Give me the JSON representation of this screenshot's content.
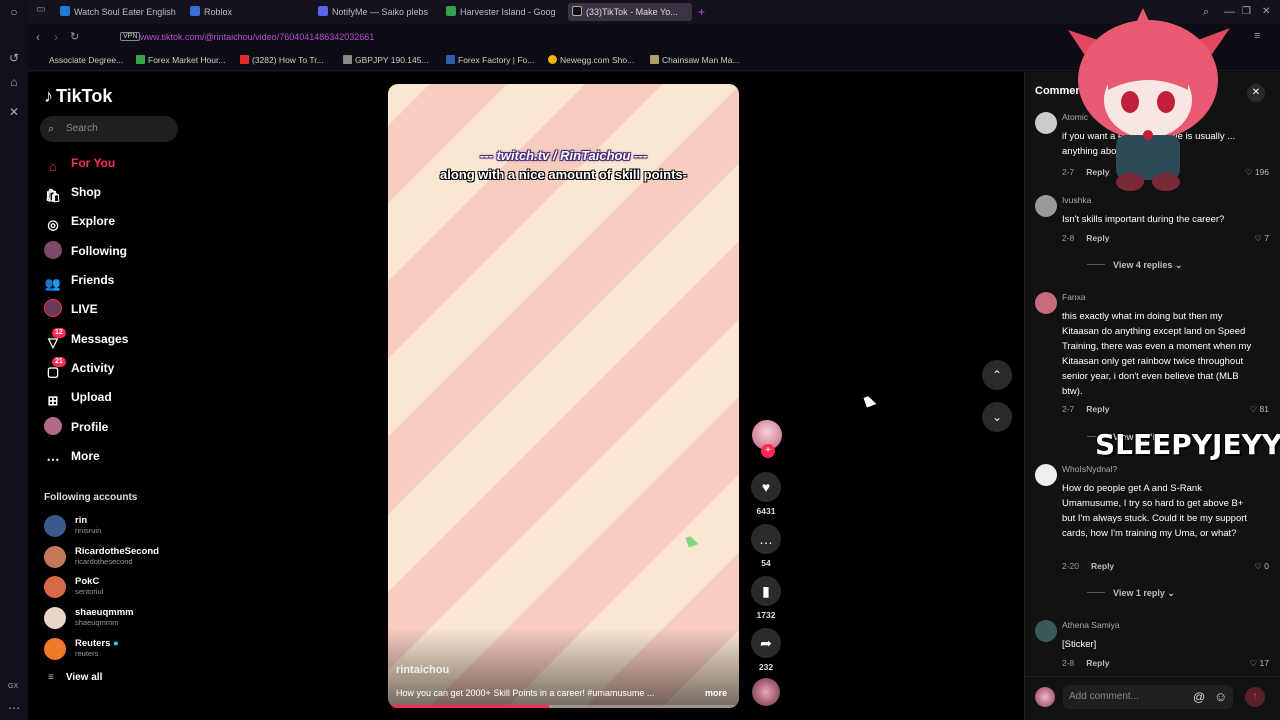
{
  "tabs": [
    {
      "label": "Watch Soul Eater English S",
      "color": "#1c7cd6"
    },
    {
      "label": "Roblox",
      "color": "#3b6fd8"
    },
    {
      "label": "NotifyMe — Saiko plebs",
      "color": "#5865f2"
    },
    {
      "label": "Harvester Island - Google",
      "color": "#2fa34f"
    },
    {
      "label": "(33)TikTok - Make Yo...",
      "color": "#111111"
    }
  ],
  "address": {
    "vpn": "VPN",
    "url": "www.tiktok.com/@rintaichou/video/7604041486342032661"
  },
  "bookmarks": [
    {
      "label": "Associate Degree...",
      "color": "#444444"
    },
    {
      "label": "Forex Market Hour...",
      "color": "#3aa64a"
    },
    {
      "label": "(3282) How To Tr...",
      "color": "#e52d27"
    },
    {
      "label": "GBPJPY 190.145...",
      "color": "#888888"
    },
    {
      "label": "Forex Factory | Fo...",
      "color": "#2d5ea8"
    },
    {
      "label": "Newegg.com Sho...",
      "color": "#f5b400"
    },
    {
      "label": "Chainsaw Man Ma...",
      "color": "#aaa06a"
    }
  ],
  "brand": {
    "name": "TikTok"
  },
  "search": {
    "placeholder": "Search"
  },
  "nav": [
    {
      "label": "For You",
      "icon": "home-icon"
    },
    {
      "label": "Shop",
      "icon": "shop-icon"
    },
    {
      "label": "Explore",
      "icon": "compass-icon"
    },
    {
      "label": "Following",
      "icon": "following-icon"
    },
    {
      "label": "Friends",
      "icon": "friends-icon"
    },
    {
      "label": "LIVE",
      "icon": "live-icon"
    },
    {
      "label": "Messages",
      "icon": "messages-icon",
      "badge": "12"
    },
    {
      "label": "Activity",
      "icon": "activity-icon",
      "badge": "21"
    },
    {
      "label": "Upload",
      "icon": "upload-icon"
    },
    {
      "label": "Profile",
      "icon": "profile-icon"
    },
    {
      "label": "More",
      "icon": "more-icon"
    }
  ],
  "following_accounts": {
    "title": "Following accounts",
    "items": [
      {
        "name": "rin",
        "handle": "rinisruin"
      },
      {
        "name": "RicardotheSecond",
        "handle": "ricardothesecond"
      },
      {
        "name": "PokC",
        "handle": "sentoriul"
      },
      {
        "name": "shaeuqmmm",
        "handle": "shaeuqmmm"
      },
      {
        "name": "Reuters",
        "handle": "reuters"
      }
    ],
    "view_all": "View all"
  },
  "video": {
    "caption_line1": "--- twitch.tv / RinTaichou ---",
    "caption_line2": "along with a nice amount of skill points-",
    "author": "rintaichou",
    "description": "How you can get 2000+ Skill Points in a career! #umamusume ...",
    "more": "more",
    "progress": 0.46
  },
  "actions": {
    "likes": "6431",
    "comments": "54",
    "saves": "1732",
    "shares": "232"
  },
  "comments": {
    "title": "Comments",
    "items": [
      {
        "user": "Atomic",
        "text": "if you want a easy ... the rule is usually ... anything above 40",
        "date": "2-7",
        "reply": "Reply",
        "likes": "196"
      },
      {
        "user": "Ivushka",
        "text": "Isn't skills important during the career?",
        "date": "2-8",
        "reply": "Reply",
        "likes": "7",
        "view_replies": "View 4 replies"
      },
      {
        "user": "Fanxa",
        "text": "this exactly what im doing but then my Kitaasan do anything except land on Speed Training, there was even a moment when my Kitaasan only get rainbow twice throughout senior year, i don't even believe that (MLB btw).",
        "date": "2-7",
        "reply": "Reply",
        "likes": "81",
        "view_replies": "View replies"
      },
      {
        "user": "WhoIsNydnal?",
        "text": "How do people get A and S-Rank Umamusume, I try so hard to get above B+ but I'm always stuck. Could it be my support cards, how I'm training my Uma, or what?",
        "date": "2-20",
        "reply": "Reply",
        "likes": "0",
        "view_replies": "View 1 reply"
      },
      {
        "user": "Athena Samiya",
        "text": "[Sticker]",
        "date": "2-8",
        "reply": "Reply",
        "likes": "17"
      }
    ],
    "add_placeholder": "Add comment..."
  },
  "overlay": {
    "watermark": "SLEEPYJEYY"
  },
  "browser_label": "GX"
}
